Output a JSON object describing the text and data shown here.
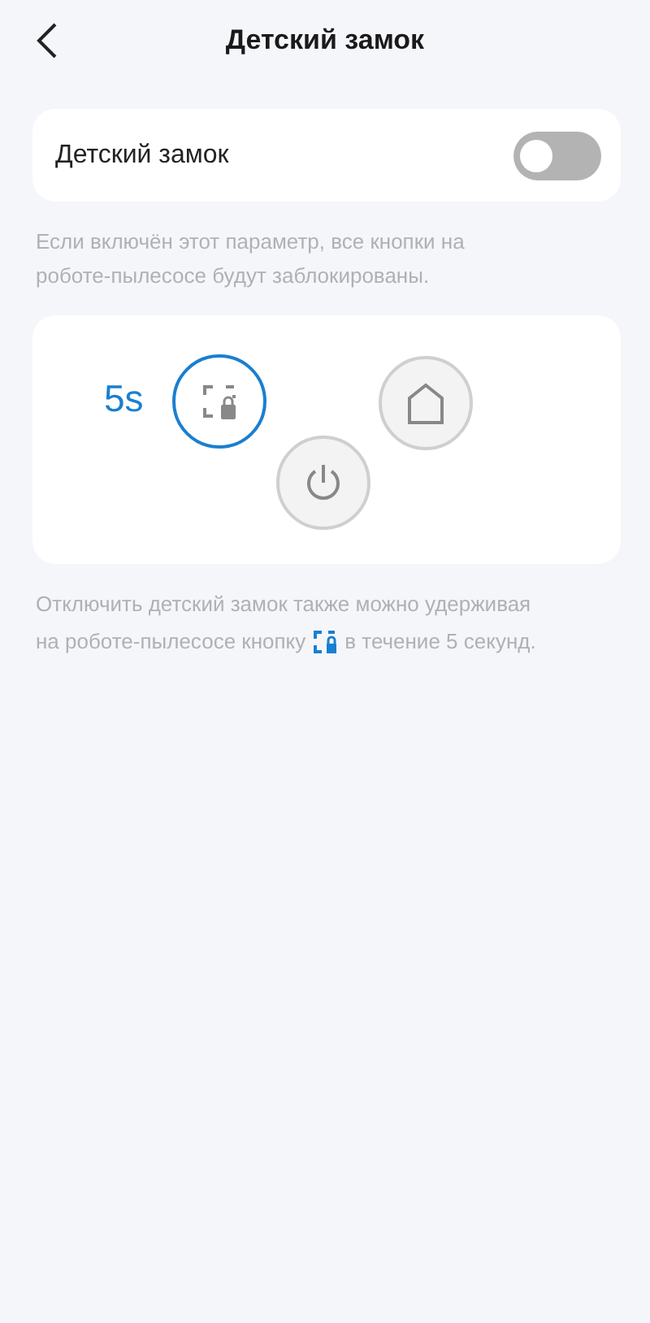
{
  "header": {
    "title": "Детский замок"
  },
  "setting": {
    "label": "Детский замок",
    "on": false
  },
  "hint": "Если включён этот параметр, все кнопки на роботе-пылесосе будут заблокированы.",
  "diagram": {
    "hold_time": "5s",
    "buttons": [
      {
        "kind": "lock",
        "selected": true
      },
      {
        "kind": "home",
        "selected": false
      },
      {
        "kind": "power",
        "selected": false
      }
    ]
  },
  "note": {
    "line_1": "Отключить детский замок также можно удерживая",
    "line_2_before": "на роботе-пылесосе кнопку",
    "line_2_after": "в течение 5 секунд."
  }
}
